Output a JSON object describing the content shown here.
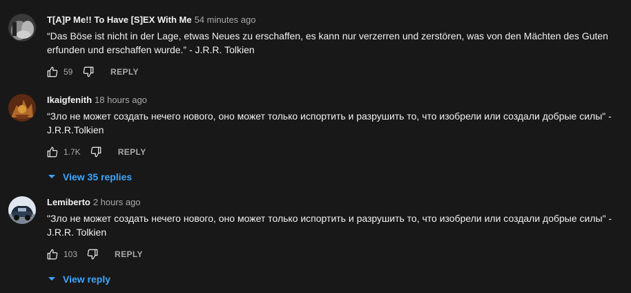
{
  "colors": {
    "background": "#181818",
    "text": "#f1f1f1",
    "secondary": "#aaaaaa",
    "link": "#3ea6ff"
  },
  "comments": [
    {
      "author": "T[A]P Me!! To Have [S]EX With Me",
      "time": "54 minutes ago",
      "text": "“Das Böse ist nicht in der Lage, etwas Neues zu erschaffen, es kann nur verzerren und zerstören, was von den Mächten des Guten erfunden und erschaffen wurde.” - J.R.R. Tolkien",
      "likes": "59",
      "reply_label": "REPLY",
      "avatar_icon": "user-avatar"
    },
    {
      "author": "Ikaigfenith",
      "time": "18 hours ago",
      "text": "“Зло не может создать нечего нового, оно может только испортить и разрушить то, что изобрели или создали добрые силы\" - J.R.R.Tolkien",
      "likes": "1.7K",
      "reply_label": "REPLY",
      "view_replies": "View 35 replies",
      "avatar_icon": "dragon-avatar"
    },
    {
      "author": "Lemiberto",
      "time": "2 hours ago",
      "text": "\"Зло не может создать нечего нового, оно может только испортить и разрушить то, что изобрели или создали добрые силы\" - J.R.R. Tolkien",
      "likes": "103",
      "reply_label": "REPLY",
      "view_replies": "View reply",
      "avatar_icon": "car-avatar"
    }
  ]
}
